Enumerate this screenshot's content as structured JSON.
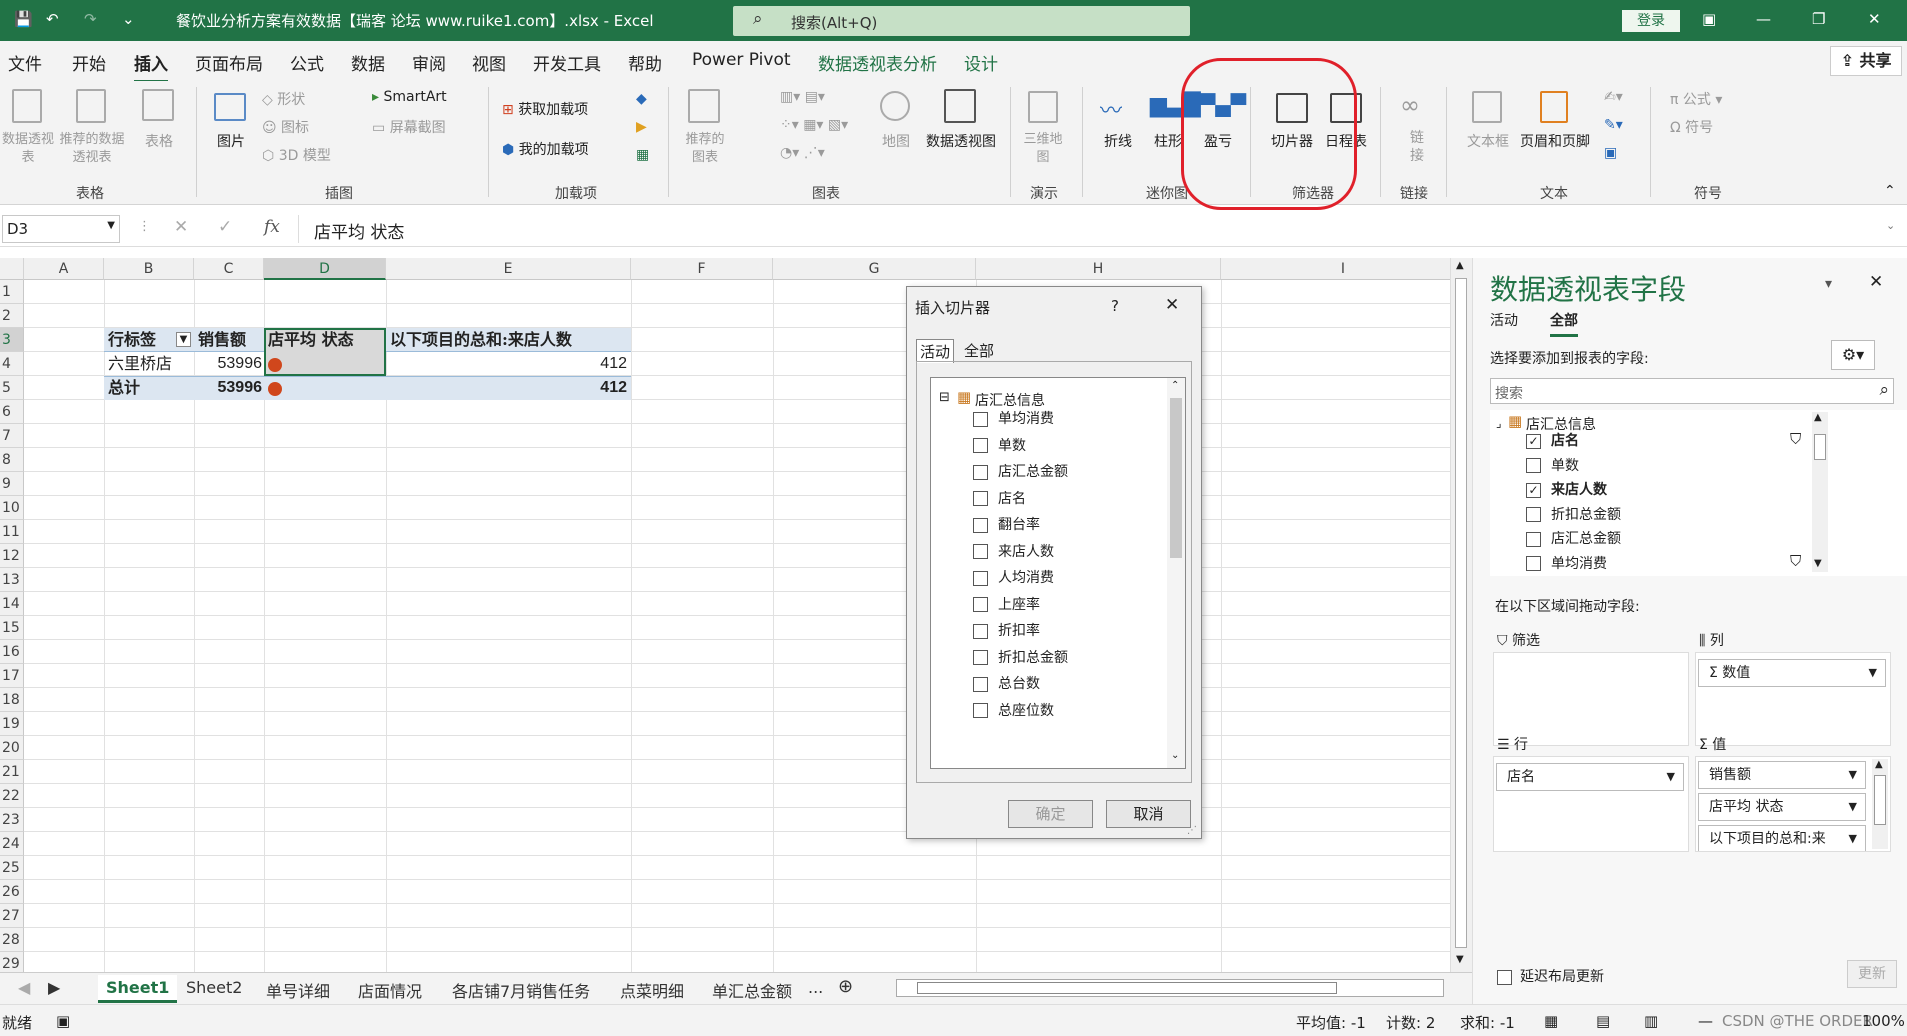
{
  "titlebar": {
    "title": "餐饮业分析方案有效数据【瑞客 论坛 www.ruike1.com】.xlsx  -  Excel",
    "search_placeholder": "搜索(Alt+Q)",
    "login": "登录"
  },
  "menu": {
    "tabs": [
      "文件",
      "开始",
      "插入",
      "页面布局",
      "公式",
      "数据",
      "审阅",
      "视图",
      "开发工具",
      "帮助",
      "Power Pivot",
      "数据透视表分析",
      "设计"
    ],
    "active_tab": "插入",
    "share": "共享"
  },
  "ribbon": {
    "groups": {
      "tables": "表格",
      "illustrations": "插图",
      "addins": "加载项",
      "charts": "图表",
      "tours": "演示",
      "sparklines": "迷你图",
      "filters": "筛选器",
      "links": "链接",
      "text": "文本",
      "symbols": "符号"
    },
    "buttons": {
      "pivot_table": "数据透视表",
      "recommended_pivot": "推荐的数据透视表",
      "table": "表格",
      "picture": "图片",
      "shapes": "形状",
      "icons": "图标",
      "model_3d": "3D 模型",
      "smartart": "SmartArt",
      "screenshot": "屏幕截图",
      "get_addins": "获取加载项",
      "my_addins": "我的加载项",
      "recommended_charts": "推荐的图表",
      "map": "地图",
      "pivot_chart": "数据透视图",
      "map_3d": "三维地图",
      "line": "折线",
      "column": "柱形",
      "winloss": "盈亏",
      "slicer": "切片器",
      "timeline": "日程表",
      "link": "链接",
      "textbox": "文本框",
      "header_footer": "页眉和页脚",
      "formula": "公式",
      "symbol": "符号"
    }
  },
  "formula_bar": {
    "name_box": "D3",
    "content": "店平均 状态"
  },
  "grid": {
    "columns": [
      "A",
      "B",
      "C",
      "D",
      "E",
      "F",
      "G",
      "H",
      "I"
    ],
    "rows": [
      "1",
      "2",
      "3",
      "4",
      "5",
      "6",
      "7",
      "8",
      "9",
      "10",
      "11",
      "12",
      "13",
      "14",
      "15",
      "16",
      "17",
      "18",
      "19",
      "20",
      "21",
      "22",
      "23",
      "24",
      "25",
      "26",
      "27",
      "28",
      "29"
    ],
    "header_row": {
      "b": "行标签",
      "c": "销售额",
      "d": "店平均 状态",
      "e": "以下项目的总和:来店人数"
    },
    "data_row": {
      "b": "六里桥店",
      "c": "53996",
      "e": "412"
    },
    "total_row": {
      "b": "总计",
      "c": "53996",
      "e": "412"
    }
  },
  "sheets": {
    "tabs": [
      "Sheet1",
      "Sheet2",
      "单号详细",
      "店面情况",
      "各店铺7月销售任务",
      "点菜明细",
      "单汇总金额",
      "..."
    ],
    "active": "Sheet1"
  },
  "statusbar": {
    "ready": "就绪",
    "average": "平均值: -1",
    "count": "计数: 2",
    "sum": "求和: -1",
    "zoom": "100%",
    "watermark": "CSDN @THE ORDER"
  },
  "dialog": {
    "title": "插入切片器",
    "help": "?",
    "tab_active": "活动",
    "tab_all": "全部",
    "group": "店汇总信息",
    "fields": [
      "单均消费",
      "单数",
      "店汇总金额",
      "店名",
      "翻台率",
      "来店人数",
      "人均消费",
      "上座率",
      "折扣率",
      "折扣总金额",
      "总台数",
      "总座位数"
    ],
    "ok": "确定",
    "cancel": "取消"
  },
  "panel": {
    "title": "数据透视表字段",
    "tab_active": "活动",
    "tab_all": "全部",
    "choose_label": "选择要添加到报表的字段:",
    "search_placeholder": "搜索",
    "group": "店汇总信息",
    "fields": [
      {
        "name": "店名",
        "checked": true
      },
      {
        "name": "单数",
        "checked": false
      },
      {
        "name": "来店人数",
        "checked": true
      },
      {
        "name": "折扣总金额",
        "checked": false
      },
      {
        "name": "店汇总金额",
        "checked": false
      },
      {
        "name": "单均消费",
        "checked": false
      }
    ],
    "drag_label": "在以下区域间拖动字段:",
    "filter_label": "筛选",
    "columns_label": "列",
    "rows_label": "行",
    "values_label": "值",
    "columns_items": [
      "Σ 数值"
    ],
    "rows_items": [
      "店名"
    ],
    "values_items": [
      "销售额",
      "店平均 状态",
      "以下项目的总和:来"
    ],
    "defer_label": "延迟布局更新",
    "update": "更新"
  },
  "colors": {
    "accent": "#217346",
    "annotation": "#e0202a",
    "indicator": "#d0471c"
  }
}
